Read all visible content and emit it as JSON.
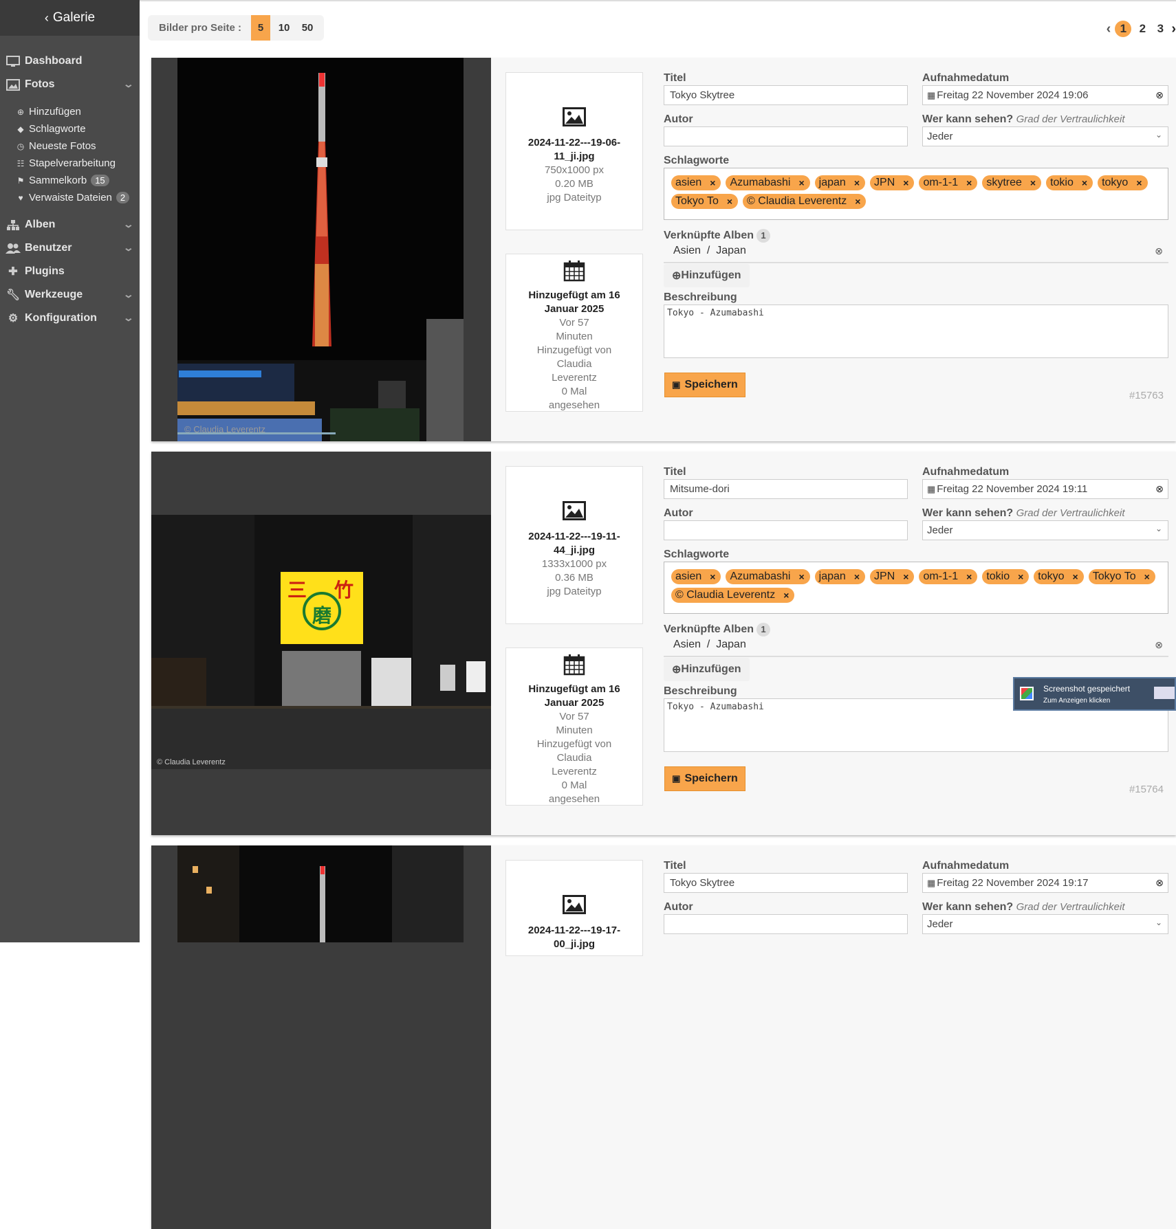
{
  "sidebar": {
    "back_label": "Galerie",
    "main_items": [
      {
        "label": "Dashboard",
        "icon": "monitor-icon"
      },
      {
        "label": "Fotos",
        "icon": "image-icon"
      },
      {
        "label": "Alben",
        "icon": "sitemap-icon"
      },
      {
        "label": "Benutzer",
        "icon": "users-icon"
      },
      {
        "label": "Plugins",
        "icon": "puzzle-icon"
      },
      {
        "label": "Werkzeuge",
        "icon": "wrench-icon"
      },
      {
        "label": "Konfiguration",
        "icon": "gear-icon"
      }
    ],
    "sub_items": [
      {
        "label": "Hinzufügen",
        "icon": "plus-circle-icon"
      },
      {
        "label": "Schlagworte",
        "icon": "tags-icon"
      },
      {
        "label": "Neueste Fotos",
        "icon": "clock-icon"
      },
      {
        "label": "Stapelverarbeitung",
        "icon": "grid-icon"
      },
      {
        "label": "Sammelkorb",
        "icon": "flag-icon",
        "badge": "15"
      },
      {
        "label": "Verwaiste Dateien",
        "icon": "broken-heart-icon",
        "badge": "2"
      }
    ]
  },
  "toolbar": {
    "per_page_label": "Bilder pro Seite :",
    "per_page_options": [
      "5",
      "10",
      "50"
    ],
    "pages": [
      "1",
      "2",
      "3"
    ]
  },
  "labels": {
    "title": "Titel",
    "date": "Aufnahmedatum",
    "author": "Autor",
    "visibility": "Wer kann sehen?",
    "visibility_hint": "Grad der Vertraulichkeit",
    "tags": "Schlagworte",
    "albums": "Verknüpfte Alben",
    "add": "Hinzufügen",
    "description": "Beschreibung",
    "save": "Speichern"
  },
  "photos": [
    {
      "filename": "2024-11-22---19-06-11_ji.jpg",
      "dimensions": "750x1000 px",
      "size": "0.20 MB",
      "filetype": "jpg Dateityp",
      "added": "Hinzugefügt am 16 Januar 2025",
      "ago": "Vor 57 Minuten",
      "added_by": "Hinzugefügt von Claudia Leverentz",
      "views": "0 Mal angesehen",
      "title": "Tokyo Skytree",
      "date": "Freitag 22 November 2024 19:06",
      "author": "",
      "visibility": "Jeder",
      "tags": [
        "asien",
        "Azumabashi",
        "japan",
        "JPN",
        "om-1-1",
        "skytree",
        "tokio",
        "tokyo",
        "Tokyo To",
        "© Claudia Leverentz"
      ],
      "album_count": "1",
      "album_path": "Asien  /  Japan",
      "description": "Tokyo - Azumabashi",
      "id": "#15763",
      "watermark": "© Claudia Leverentz"
    },
    {
      "filename": "2024-11-22---19-11-44_ji.jpg",
      "dimensions": "1333x1000 px",
      "size": "0.36 MB",
      "filetype": "jpg Dateityp",
      "added": "Hinzugefügt am 16 Januar 2025",
      "ago": "Vor 57 Minuten",
      "added_by": "Hinzugefügt von Claudia Leverentz",
      "views": "0 Mal angesehen",
      "title": "Mitsume-dori",
      "date": "Freitag 22 November 2024 19:11",
      "author": "",
      "visibility": "Jeder",
      "tags": [
        "asien",
        "Azumabashi",
        "japan",
        "JPN",
        "om-1-1",
        "tokio",
        "tokyo",
        "Tokyo To",
        "© Claudia Leverentz"
      ],
      "album_count": "1",
      "album_path": "Asien  /  Japan",
      "description": "Tokyo - Azumabashi",
      "id": "#15764",
      "watermark": "© Claudia Leverentz",
      "sign_chars": [
        "三",
        "竹",
        "磨"
      ]
    },
    {
      "filename": "2024-11-22---19-17-00_ji.jpg",
      "title": "Tokyo Skytree",
      "date": "Freitag 22 November 2024 19:17",
      "author": "",
      "visibility": "Jeder"
    }
  ],
  "toast": {
    "title": "Screenshot gespeichert",
    "subtitle": "Zum Anzeigen klicken"
  },
  "colors": {
    "accent": "#f8a54b",
    "sidebar": "#4a4a4a"
  }
}
